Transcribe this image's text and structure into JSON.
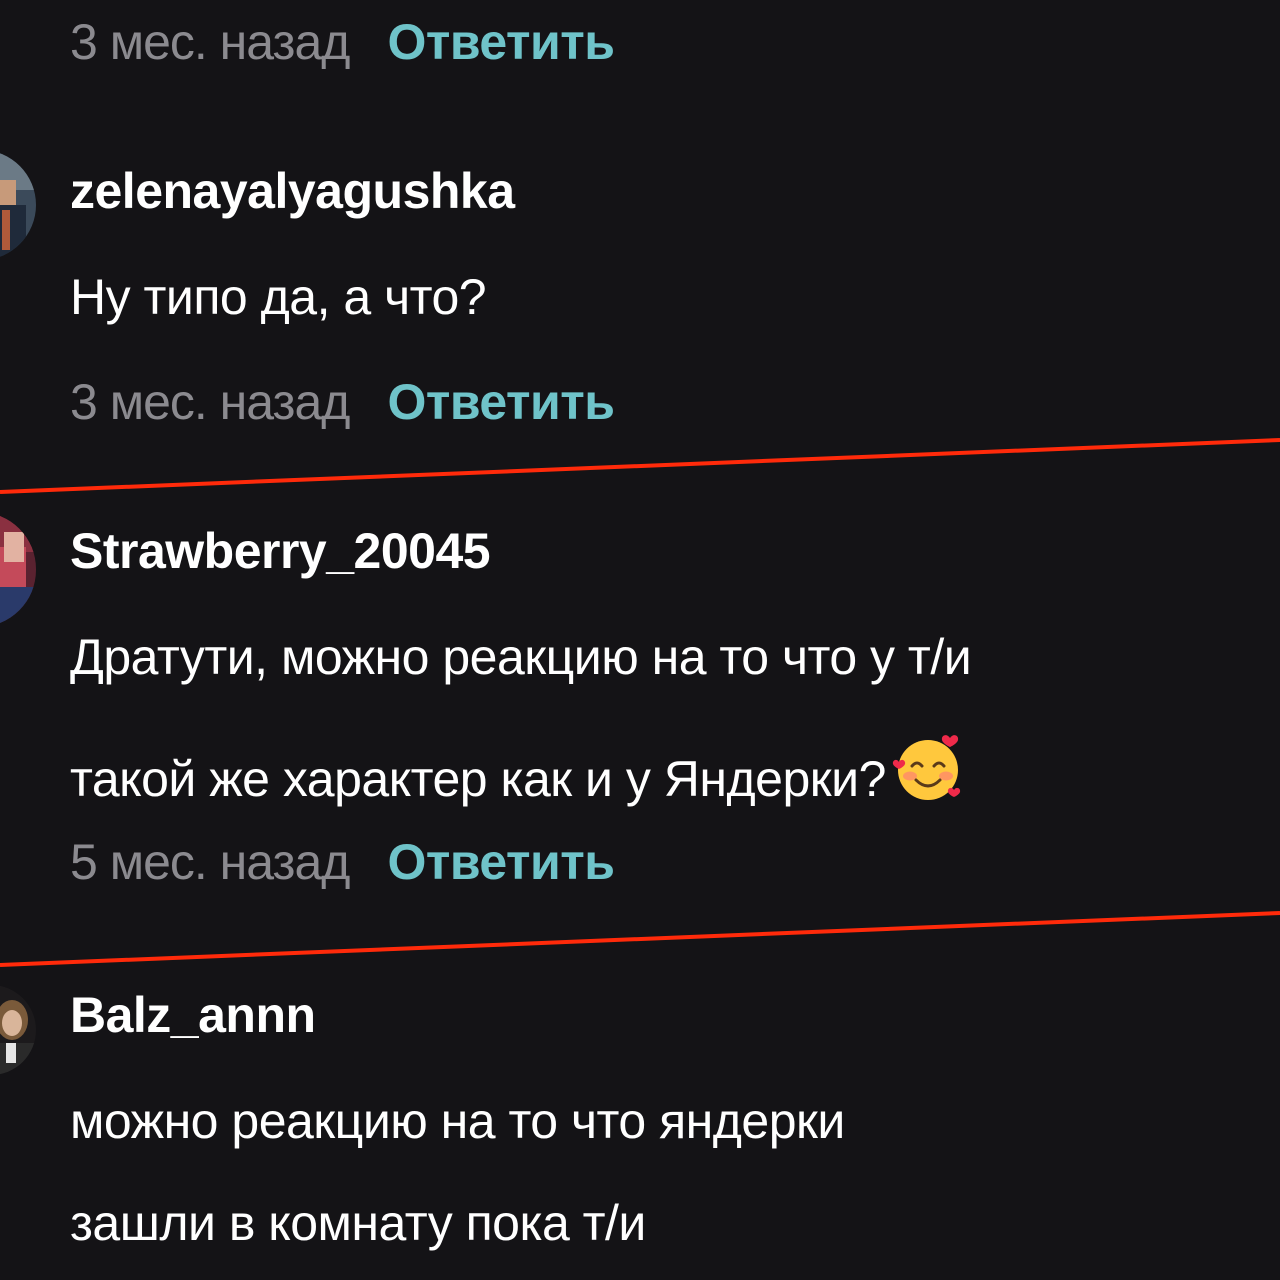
{
  "comments": [
    {
      "time": "3 мес. назад",
      "reply_label": "Ответить"
    },
    {
      "username": "zelenayalyagushka",
      "lines": [
        "Ну типо да, а что?"
      ],
      "time": "3 мес. назад",
      "reply_label": "Ответить"
    },
    {
      "username": "Strawberry_20045",
      "lines": [
        "Дратути, можно реакцию на то что у т/и",
        "такой же характер как и у Яндерки?"
      ],
      "emoji": "smiling-face-with-hearts",
      "time": "5 мес. назад",
      "reply_label": "Ответить"
    },
    {
      "username": "Balz_annn",
      "lines": [
        "можно реакцию на то что яндерки",
        "зашли в комнату пока т/и"
      ]
    }
  ],
  "colors": {
    "background": "#141316",
    "username": "#ffffff",
    "text": "#ffffff",
    "time": "#8b8a8f",
    "reply": "#6fc3c9",
    "divider": "#ff2a0a"
  }
}
